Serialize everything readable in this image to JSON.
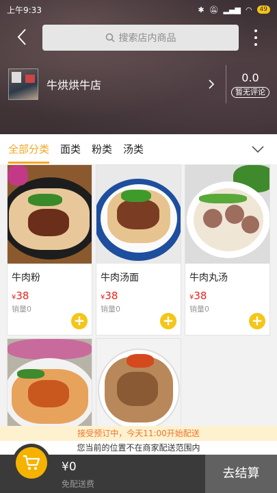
{
  "status_bar": {
    "time": "上午9:33",
    "battery": "49"
  },
  "search": {
    "placeholder": "搜索店内商品"
  },
  "shop": {
    "name": "牛烘烘牛店",
    "rating": "0.0",
    "rating_badge": "暂无评论"
  },
  "tabs": [
    {
      "label": "全部分类",
      "active": true
    },
    {
      "label": "面类",
      "active": false
    },
    {
      "label": "粉类",
      "active": false
    },
    {
      "label": "汤类",
      "active": false
    }
  ],
  "products": [
    {
      "name": "牛肉粉",
      "currency": "¥",
      "price": "38",
      "sales": "销量0"
    },
    {
      "name": "牛肉汤面",
      "currency": "¥",
      "price": "38",
      "sales": "销量0"
    },
    {
      "name": "牛肉丸汤",
      "currency": "¥",
      "price": "38",
      "sales": "销量0"
    },
    {
      "name": "",
      "currency": "",
      "price": "",
      "sales": ""
    },
    {
      "name": "",
      "currency": "",
      "price": "",
      "sales": ""
    }
  ],
  "notice": {
    "preorder": "接受预订中，今天11:00开始配送",
    "delivery_range": "您当前的位置不在商家配送范围内"
  },
  "cart": {
    "total": "¥0",
    "delivery_fee": "免配送费",
    "checkout_label": "去结算"
  },
  "colors": {
    "accent": "#f5a623",
    "price": "#e2231a",
    "add_button": "#f5c518",
    "bottom_bar": "#3a3a3a"
  }
}
